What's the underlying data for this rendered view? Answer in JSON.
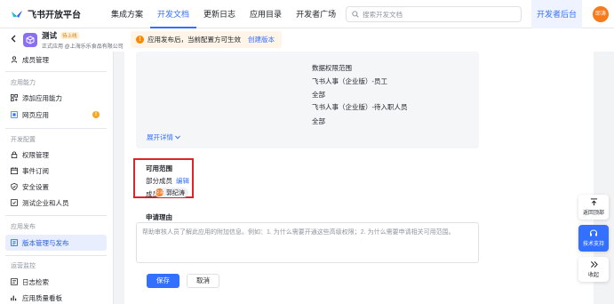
{
  "topbar": {
    "logo_text": "飞书开放平台",
    "nav": [
      "集成方案",
      "开发文档",
      "更新日志",
      "应用目录",
      "开发者广场"
    ],
    "active_nav": "开发文档",
    "search_placeholder": "搜索开发文档",
    "dev_console": "开发者后台",
    "user_avatar": "邱涛"
  },
  "app": {
    "name": "测试",
    "badge": "待上线",
    "subtitle": "正式应用 @上海乐乐食品有限公司",
    "notice": "应用发布后，当前配置方可生效",
    "notice_link": "创建版本"
  },
  "sidebar": {
    "top_item": "成员管理",
    "groups": [
      "应用能力",
      "开发配置",
      "应用发布",
      "运营监控"
    ],
    "items": {
      "add_capability": "添加应用能力",
      "web_app": "网页应用",
      "permissions": "权限管理",
      "events": "事件订阅",
      "security": "安全设置",
      "test_users": "测试企业和人员",
      "version_release": "版本管理与发布",
      "log_search": "日志检索",
      "quality_board": "应用质量看板"
    }
  },
  "main": {
    "scope_title": "数据权限范围",
    "scope_lines": [
      "飞书人事（企业版）-员工",
      "全部",
      "飞书人事（企业版）-待入职人员",
      "全部"
    ],
    "expand": "展开详情",
    "available_scope": "可用范围",
    "partial_members": "部分成员",
    "edit": "编辑",
    "members_label": "成员：",
    "member_name": "郭纪涛",
    "member_avatar": "纪涛",
    "reason_title": "申请理由",
    "reason_placeholder": "帮助审核人员了解此应用的附加信息。例如：1. 为什么需要开通这些高级权限；2. 为什么需要申请相关可用范围。",
    "save": "保存",
    "cancel": "取消"
  },
  "floating": {
    "back_top": "返回顶部",
    "support": "技术支持",
    "collapse": "收起"
  },
  "colors": {
    "accent": "#3370ff",
    "highlight_box": "#d9262b",
    "warning": "#ff8800"
  }
}
